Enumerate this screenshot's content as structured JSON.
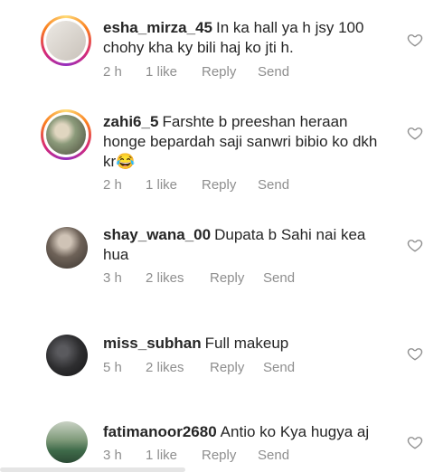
{
  "comments": [
    {
      "username": "esha_mirza_45",
      "text": "In ka hall ya h jsy 100 chohy kha ky bili haj ko jti h.",
      "time": "2 h",
      "likes": "1 like",
      "reply": "Reply",
      "send": "Send",
      "avatar_color": "#d8d4cf"
    },
    {
      "username": "zahi6_5",
      "text": "Farshte b preeshan heraan honge bepardah saji sanwri bibio ko dkh kr😂",
      "time": "2 h",
      "likes": "1 like",
      "reply": "Reply",
      "send": "Send",
      "avatar_color": "#8b9a7a"
    },
    {
      "username": "shay_wana_00",
      "text": "Dupata b Sahi nai kea hua",
      "time": "3 h",
      "likes": "2 likes",
      "reply": "Reply",
      "send": "Send",
      "avatar_color": "#6e6258"
    },
    {
      "username": "miss_subhan",
      "text": "Full makeup",
      "time": "5 h",
      "likes": "2 likes",
      "reply": "Reply",
      "send": "Send",
      "avatar_color": "#2e2e30"
    },
    {
      "username": "fatimanoor2680",
      "text": "Antio ko Kya hugya aj",
      "time": "3 h",
      "likes": "1 like",
      "reply": "Reply",
      "send": "Send",
      "avatar_color": "#3f6b4a"
    }
  ]
}
